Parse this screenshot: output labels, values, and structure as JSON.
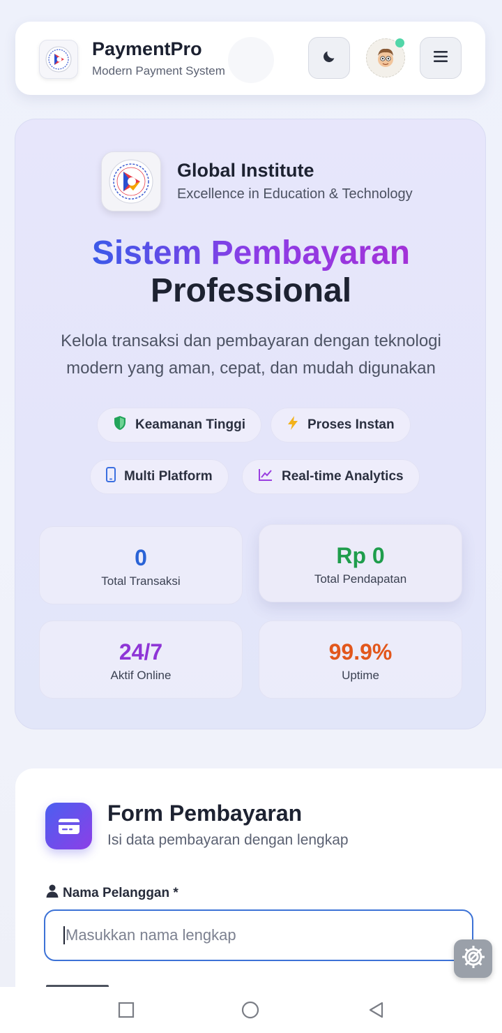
{
  "header": {
    "brand_title": "PaymentPro",
    "brand_subtitle": "Modern Payment System",
    "icons": [
      "institute-logo-icon",
      "moon-icon",
      "avatar",
      "hamburger-menu-icon"
    ],
    "online_status_color": "#52d6a8"
  },
  "hero": {
    "institute_name": "Global Institute",
    "institute_tagline": "Excellence in Education & Technology",
    "title_gradient": "Sistem Pembayaran",
    "title_plain": "Professional",
    "description": "Kelola transaksi dan pembayaran dengan teknologi modern yang aman, cepat, dan mudah digunakan",
    "features": [
      {
        "label": "Keamanan Tinggi",
        "icon": "shield-icon",
        "color": "#22a35a"
      },
      {
        "label": "Proses Instan",
        "icon": "lightning-icon",
        "color": "#f2b21b"
      },
      {
        "label": "Multi Platform",
        "icon": "phone-icon",
        "color": "#3b6fe0"
      },
      {
        "label": "Real-time Analytics",
        "icon": "chart-line-icon",
        "color": "#9a3fe0"
      }
    ],
    "stats": [
      {
        "value": "0",
        "label": "Total Transaksi",
        "color": "#2a63d6"
      },
      {
        "value": "Rp 0",
        "label": "Total Pendapatan",
        "color": "#1f9d4c"
      },
      {
        "value": "24/7",
        "label": "Aktif Online",
        "color": "#8e35d6"
      },
      {
        "value": "99.9%",
        "label": "Uptime",
        "color": "#e2571c"
      }
    ]
  },
  "form": {
    "title": "Form Pembayaran",
    "subtitle": "Isi data pembayaran dengan lengkap",
    "name_label": "Nama Pelanggan *",
    "name_value": "",
    "name_placeholder": "Masukkan nama lengkap"
  },
  "system_nav": {
    "buttons": [
      "recents-square-icon",
      "home-circle-icon",
      "back-triangle-icon"
    ]
  }
}
